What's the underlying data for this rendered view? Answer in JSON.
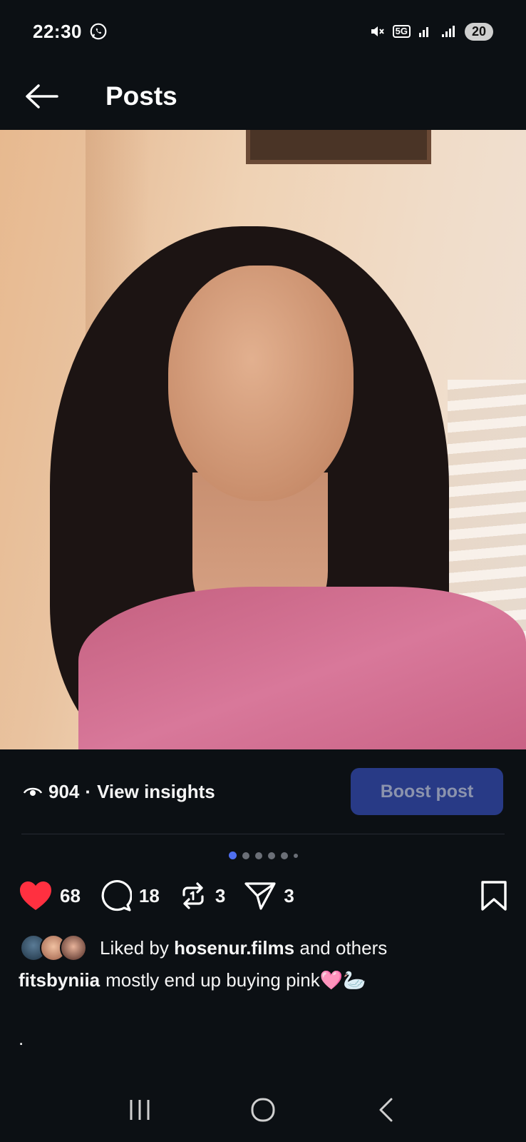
{
  "status_bar": {
    "time": "22:30",
    "network": "5G",
    "battery": "20",
    "icons": [
      "whatsapp-icon",
      "mute-icon",
      "5g-icon",
      "signal-icon",
      "signal-icon",
      "battery-icon"
    ]
  },
  "header": {
    "title": "Posts",
    "back_icon": "arrow-left-icon"
  },
  "insights": {
    "views": "904",
    "separator": "·",
    "link_label": "View insights",
    "boost_label": "Boost post"
  },
  "carousel": {
    "total_dots": 6,
    "active_index": 0
  },
  "actions": {
    "likes": "68",
    "comments": "18",
    "reposts": "3",
    "shares": "3"
  },
  "liked_by": {
    "prefix": "Liked by",
    "user": "hosenur.films",
    "suffix": "and others"
  },
  "caption": {
    "username": "fitsbyniia",
    "text": "mostly end up buying pink🩷🦢"
  },
  "caption_extra": ".",
  "colors": {
    "background": "#0c1014",
    "heart": "#ff3040",
    "boost_bg": "#283a86",
    "active_dot": "#4f6ff0"
  }
}
